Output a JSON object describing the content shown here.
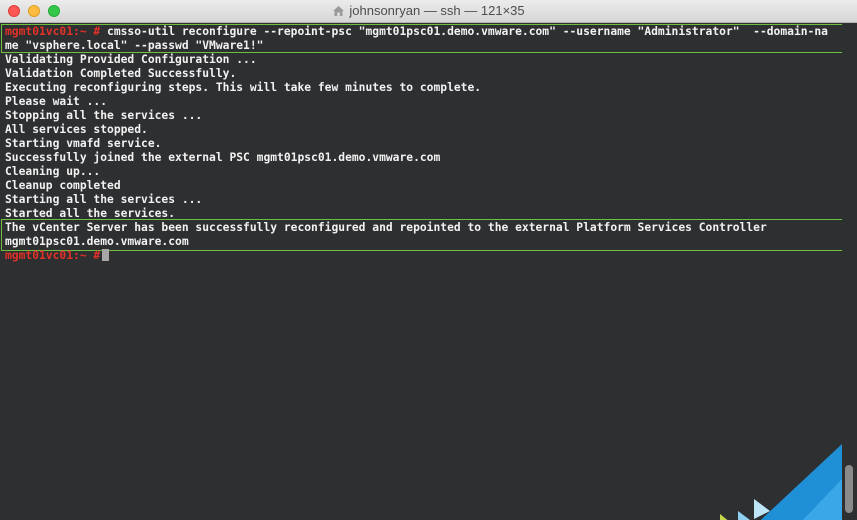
{
  "window": {
    "title": "johnsonryan — ssh — 121×35"
  },
  "terminal": {
    "prompt": "mgmt01vc01:~ #",
    "command_line_1": " cmsso-util reconfigure --repoint-psc \"mgmt01psc01.demo.vmware.com\" --username \"Administrator\"  --domain-na",
    "command_line_2": "me \"vsphere.local\" --passwd \"VMware1!\"",
    "output": [
      "Validating Provided Configuration ...",
      "Validation Completed Successfully.",
      "Executing reconfiguring steps. This will take few minutes to complete.",
      "Please wait ...",
      "Stopping all the services ...",
      "All services stopped.",
      "Starting vmafd service.",
      "Successfully joined the external PSC mgmt01psc01.demo.vmware.com",
      "Cleaning up...",
      "Cleanup completed",
      "Starting all the services ...",
      "Started all the services."
    ],
    "result_line_1": "The vCenter Server has been successfully reconfigured and repointed to the external Platform Services Controller",
    "result_line_2": "mgmt01psc01.demo.vmware.com",
    "final_prompt": "mgmt01vc01:~ #",
    "colors": {
      "prompt": "#e33128",
      "text": "#f2f2f2",
      "background": "#2e2f31",
      "highlight_border": "#6fbe3e"
    }
  },
  "icons": [
    "home-folder-icon",
    "close-button-icon",
    "minimize-button-icon",
    "maximize-button-icon"
  ]
}
